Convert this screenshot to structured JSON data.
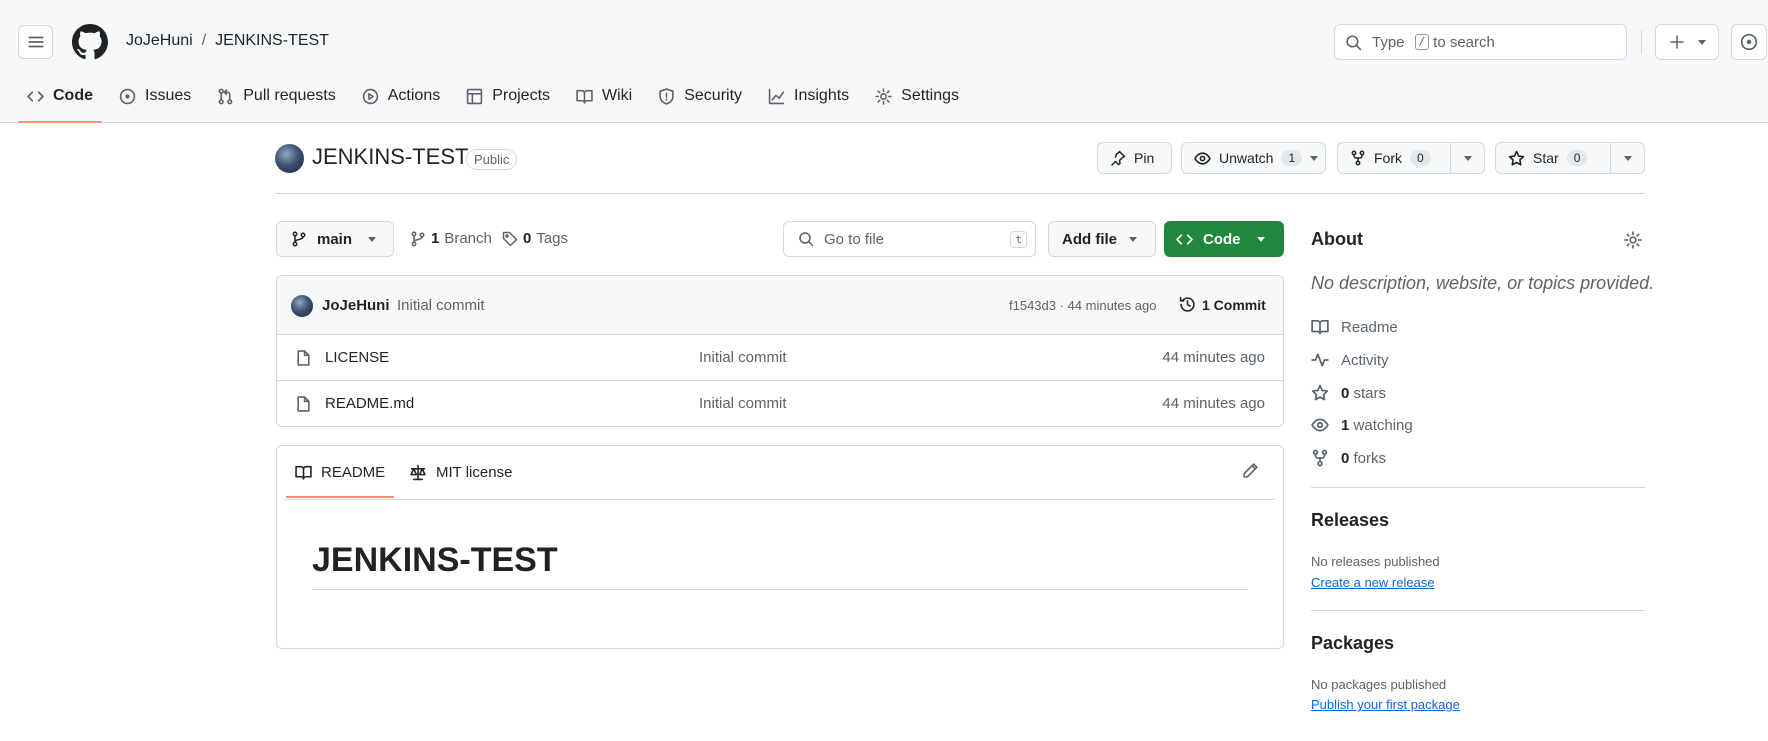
{
  "header": {
    "owner": "JoJeHuni",
    "separator": "/",
    "repo": "JENKINS-TEST",
    "search_prefix": "Type",
    "search_key": "/",
    "search_suffix": "to search"
  },
  "nav": {
    "tabs": [
      {
        "label": "Code",
        "icon": "code-icon"
      },
      {
        "label": "Issues",
        "icon": "issue-icon"
      },
      {
        "label": "Pull requests",
        "icon": "pull-request-icon"
      },
      {
        "label": "Actions",
        "icon": "play-icon"
      },
      {
        "label": "Projects",
        "icon": "table-icon"
      },
      {
        "label": "Wiki",
        "icon": "book-icon"
      },
      {
        "label": "Security",
        "icon": "shield-icon"
      },
      {
        "label": "Insights",
        "icon": "graph-icon"
      },
      {
        "label": "Settings",
        "icon": "gear-icon"
      }
    ]
  },
  "repo": {
    "name": "JENKINS-TEST",
    "visibility": "Public",
    "pin_label": "Pin",
    "unwatch_label": "Unwatch",
    "watch_count": "1",
    "fork_label": "Fork",
    "fork_count": "0",
    "star_label": "Star",
    "star_count": "0"
  },
  "toolbar": {
    "branch": "main",
    "branch_count": "1",
    "branch_label": "Branch",
    "tag_count": "0",
    "tag_label": "Tags",
    "goto_placeholder": "Go to file",
    "goto_key": "t",
    "add_file": "Add file",
    "code_label": "Code"
  },
  "commit": {
    "author": "JoJeHuni",
    "message": "Initial commit",
    "sha_time": "f1543d3 · 44 minutes ago",
    "commits_label": "1 Commit"
  },
  "files": [
    {
      "name": "LICENSE",
      "message": "Initial commit",
      "age": "44 minutes ago"
    },
    {
      "name": "README.md",
      "message": "Initial commit",
      "age": "44 minutes ago"
    }
  ],
  "readme": {
    "tab_readme": "README",
    "tab_license": "MIT license",
    "heading": "JENKINS-TEST"
  },
  "sidebar": {
    "about_title": "About",
    "description": "No description, website, or topics provided.",
    "readme": "Readme",
    "activity": "Activity",
    "stars_count": "0",
    "stars_label": "stars",
    "watching_count": "1",
    "watching_label": "watching",
    "forks_count": "0",
    "forks_label": "forks",
    "releases_title": "Releases",
    "releases_empty": "No releases published",
    "releases_link": "Create a new release",
    "packages_title": "Packages",
    "packages_empty": "No packages published",
    "packages_link": "Publish your first package"
  },
  "colors": {
    "accent_green": "#1f883d",
    "tab_underline": "#fd8c73",
    "link_blue": "#0969da"
  }
}
